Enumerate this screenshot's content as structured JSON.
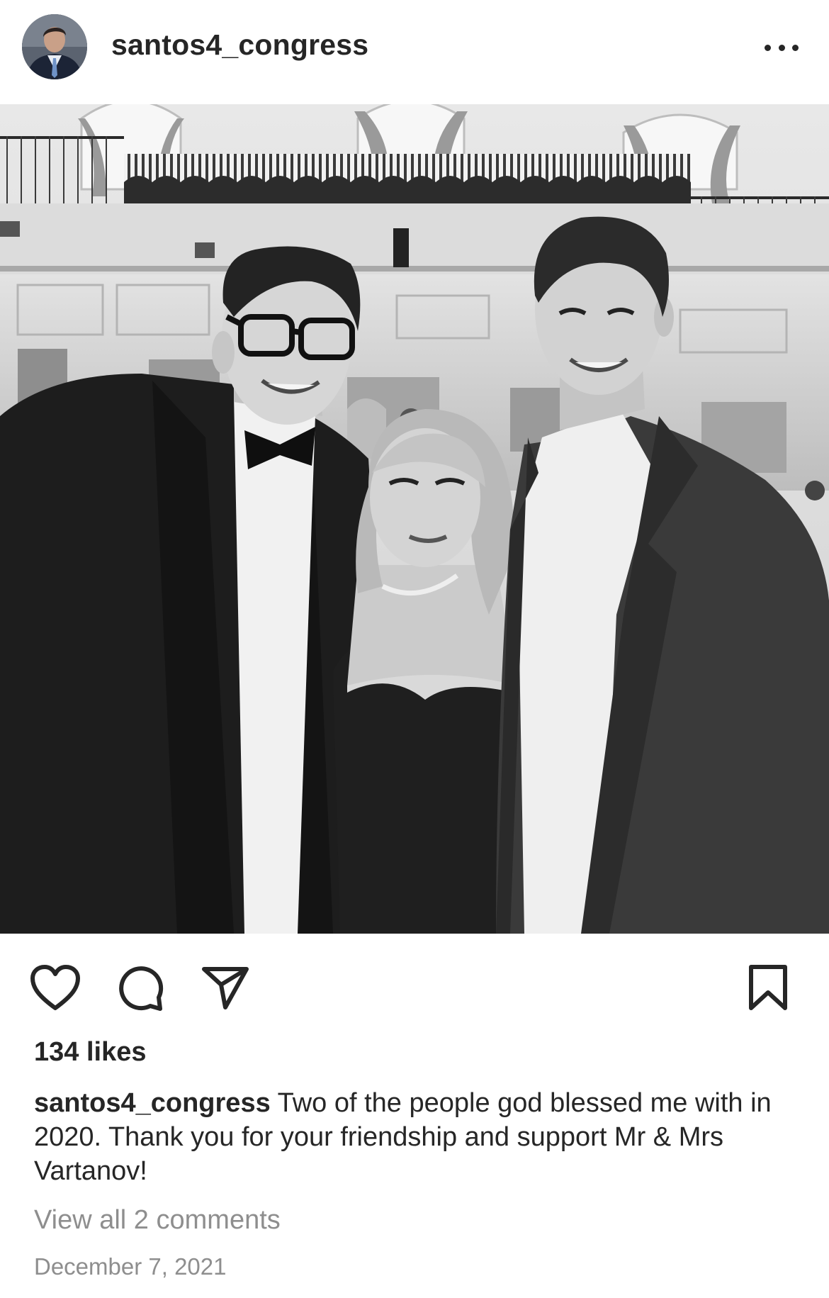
{
  "post": {
    "username": "santos4_congress",
    "likes_text": "134 likes",
    "caption_text": "Two of the people god blessed me with in 2020. Thank you for your friendship and support Mr & Mrs Vartanov!",
    "view_comments_text": "View all 2 comments",
    "date": "December 7, 2021"
  },
  "icons": {
    "more": "more-options-icon",
    "like": "heart-icon",
    "comment": "comment-bubble-icon",
    "share": "paper-plane-icon",
    "save": "bookmark-icon"
  },
  "colors": {
    "text": "#262626",
    "secondary": "#8e8e8e",
    "background": "#ffffff"
  }
}
